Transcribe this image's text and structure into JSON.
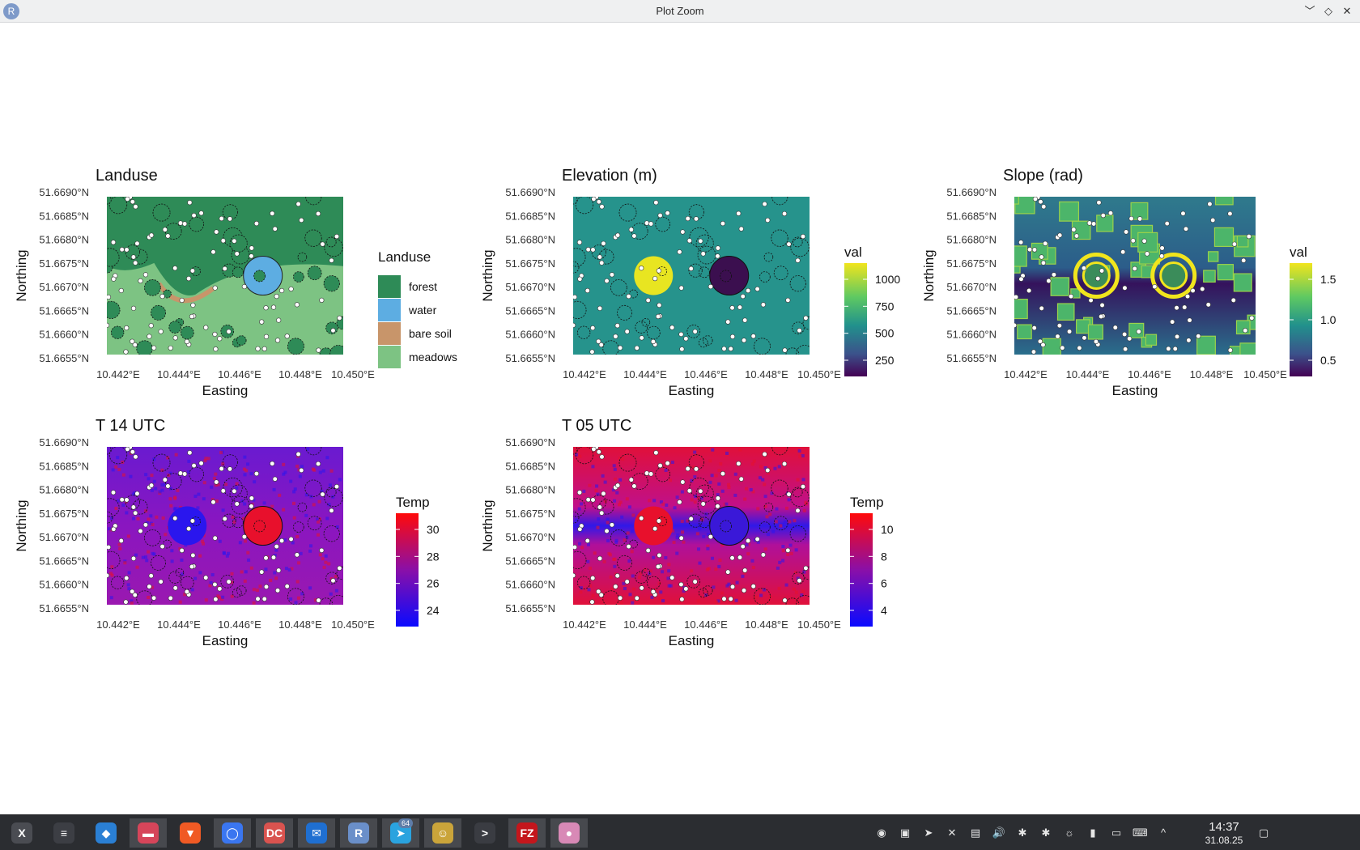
{
  "window": {
    "title": "Plot Zoom",
    "app_icon_letter": "R",
    "controls": [
      "chevron-down-icon",
      "restore-icon",
      "close-icon"
    ]
  },
  "panels": [
    {
      "key": "landuse",
      "title": "Landuse",
      "raster": "landuse",
      "xlabel": "Easting",
      "ylabel": "Northing",
      "xticks": [
        "10.442°E",
        "10.444°E",
        "10.446°E",
        "10.448°E",
        "10.450°E"
      ],
      "yticks": [
        "51.6690°N",
        "51.6685°N",
        "51.6680°N",
        "51.6675°N",
        "51.6670°N",
        "51.6665°N",
        "51.6660°N",
        "51.6655°N"
      ],
      "legend": {
        "type": "discrete",
        "title": "Landuse",
        "entries": [
          {
            "label": "forest",
            "color": "#2e8b57"
          },
          {
            "label": "water",
            "color": "#5dade2"
          },
          {
            "label": "bare soil",
            "color": "#c8956a"
          },
          {
            "label": "meadows",
            "color": "#7dc383"
          }
        ]
      }
    },
    {
      "key": "elevation",
      "title": "Elevation (m)",
      "raster": "elevation",
      "xlabel": "Easting",
      "ylabel": "Northing",
      "xticks": [
        "10.442°E",
        "10.444°E",
        "10.446°E",
        "10.448°E",
        "10.450°E"
      ],
      "yticks": [
        "51.6690°N",
        "51.6685°N",
        "51.6680°N",
        "51.6675°N",
        "51.6670°N",
        "51.6665°N",
        "51.6660°N",
        "51.6655°N"
      ],
      "legend": {
        "type": "continuous",
        "title": "val",
        "palette": "viridis",
        "labels": [
          "1000",
          "750",
          "500",
          "250"
        ]
      }
    },
    {
      "key": "slope",
      "title": "Slope (rad)",
      "raster": "slope",
      "xlabel": "Easting",
      "ylabel": "Northing",
      "xticks": [
        "10.442°E",
        "10.444°E",
        "10.446°E",
        "10.448°E",
        "10.450°E"
      ],
      "yticks": [
        "51.6690°N",
        "51.6685°N",
        "51.6680°N",
        "51.6675°N",
        "51.6670°N",
        "51.6665°N",
        "51.6660°N",
        "51.6655°N"
      ],
      "legend": {
        "type": "continuous",
        "title": "val",
        "palette": "viridis",
        "labels": [
          "1.5",
          "1.0",
          "0.5"
        ]
      }
    },
    {
      "key": "t14",
      "title": "T 14 UTC",
      "raster": "t14",
      "xlabel": "Easting",
      "ylabel": "Northing",
      "xticks": [
        "10.442°E",
        "10.444°E",
        "10.446°E",
        "10.448°E",
        "10.450°E"
      ],
      "yticks": [
        "51.6690°N",
        "51.6685°N",
        "51.6680°N",
        "51.6675°N",
        "51.6670°N",
        "51.6665°N",
        "51.6660°N",
        "51.6655°N"
      ],
      "legend": {
        "type": "continuous",
        "title": "Temp",
        "palette": "blue-red",
        "labels": [
          "30",
          "28",
          "26",
          "24"
        ]
      }
    },
    {
      "key": "t05",
      "title": "T 05 UTC",
      "raster": "t05",
      "xlabel": "Easting",
      "ylabel": "Northing",
      "xticks": [
        "10.442°E",
        "10.444°E",
        "10.446°E",
        "10.448°E",
        "10.450°E"
      ],
      "yticks": [
        "51.6690°N",
        "51.6685°N",
        "51.6680°N",
        "51.6675°N",
        "51.6670°N",
        "51.6665°N",
        "51.6660°N",
        "51.6655°N"
      ],
      "legend": {
        "type": "continuous",
        "title": "Temp",
        "palette": "blue-red",
        "labels": [
          "10",
          "8",
          "6",
          "4"
        ]
      }
    }
  ],
  "colors": {
    "forest": "#2e8b57",
    "water": "#5dade2",
    "bare_soil": "#c8956a",
    "meadows": "#7dc383",
    "elevation_base": "#26938c",
    "elevation_high": "#e8e521",
    "elevation_low": "#3b0f4f",
    "slope_base": "#2c6d8e",
    "slope_dark": "#35125c",
    "temp_hot": "#e8102c",
    "temp_cold": "#2a16ee",
    "temp_mid": "#8a18b8"
  },
  "taskbar": {
    "apps": [
      {
        "name": "system-menu-icon",
        "letter": "X",
        "color": "#4a4c52"
      },
      {
        "name": "settings-sliders-icon",
        "letter": "≡",
        "color": "#3c3e44"
      },
      {
        "name": "store-bag-icon",
        "letter": "◆",
        "color": "#2a7fd4"
      },
      {
        "name": "file-manager-icon",
        "letter": "▬",
        "color": "#d6455a"
      },
      {
        "name": "brave-browser-icon",
        "letter": "▼",
        "color": "#f05a24"
      },
      {
        "name": "signal-messenger-icon",
        "letter": "◯",
        "color": "#3a76f0"
      },
      {
        "name": "dc-app-icon",
        "letter": "DC",
        "color": "#d9534f"
      },
      {
        "name": "thunderbird-icon",
        "letter": "✉",
        "color": "#1f6fd1"
      },
      {
        "name": "r-studio-icon",
        "letter": "R",
        "color": "#6a8fc9"
      },
      {
        "name": "telegram-icon",
        "letter": "➤",
        "color": "#2aa3df"
      },
      {
        "name": "character-app-icon",
        "letter": "☺",
        "color": "#caa43a"
      },
      {
        "name": "terminal-icon",
        "letter": ">",
        "color": "#3a3c42"
      },
      {
        "name": "filezilla-icon",
        "letter": "FZ",
        "color": "#c4161c"
      },
      {
        "name": "pink-app-icon",
        "letter": "●",
        "color": "#d889b6"
      }
    ],
    "badge": "64",
    "tray": [
      "chat-status-icon",
      "screenshot-icon",
      "telegram-tray-icon",
      "xdebug-icon",
      "clipboard-icon",
      "volume-icon",
      "bluetooth-dim-icon",
      "bluetooth-icon",
      "brightness-icon",
      "usb-icon",
      "network-icon",
      "keyboard-layout-icon",
      "tray-expand-icon"
    ],
    "time": "14:37",
    "date": "31.08.25"
  }
}
